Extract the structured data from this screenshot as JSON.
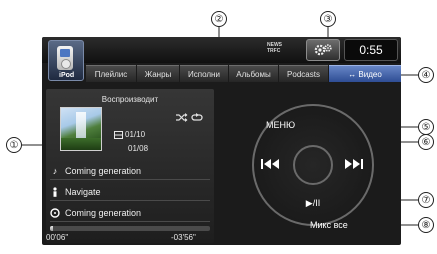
{
  "header": {
    "source_label": "iPod",
    "status_lines": [
      "NEWS",
      "TRFC"
    ],
    "clock": "0:55"
  },
  "tabs": [
    {
      "label": "Плейлис"
    },
    {
      "label": "Жанры"
    },
    {
      "label": "Исполни"
    },
    {
      "label": "Альбомы"
    },
    {
      "label": "Podcasts"
    },
    {
      "label": "↔ Видео",
      "active": true
    }
  ],
  "now_playing": {
    "title": "Воспроизводит",
    "track_counter": "01/10",
    "album_counter": "01/08",
    "song": "Coming generation",
    "artist": "Navigate",
    "album": "Coming generation",
    "progress": 0.02,
    "elapsed": "00'06\"",
    "remaining": "-03'56\""
  },
  "controls": {
    "menu": "МЕНЮ",
    "play_pause": "▶/II",
    "mix_all": "Микс все"
  },
  "callouts": [
    "①",
    "②",
    "③",
    "④",
    "⑤",
    "⑥",
    "⑦",
    "⑧"
  ],
  "colors": {
    "video_tab": "#3e5ea6",
    "screen_bg": "#1b1b1b"
  },
  "icons": [
    "ipod-icon",
    "settings-gear-icon",
    "shuffle-icon",
    "repeat-icon",
    "track-icon",
    "note-icon",
    "artist-icon",
    "album-icon",
    "prev-track-icon",
    "next-track-icon"
  ]
}
